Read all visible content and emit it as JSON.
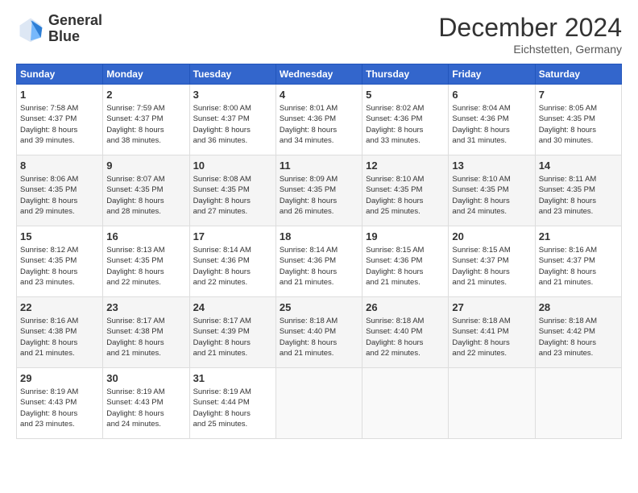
{
  "logo": {
    "line1": "General",
    "line2": "Blue"
  },
  "title": "December 2024",
  "location": "Eichstetten, Germany",
  "headers": [
    "Sunday",
    "Monday",
    "Tuesday",
    "Wednesday",
    "Thursday",
    "Friday",
    "Saturday"
  ],
  "weeks": [
    [
      {
        "day": "1",
        "lines": [
          "Sunrise: 7:58 AM",
          "Sunset: 4:37 PM",
          "Daylight: 8 hours",
          "and 39 minutes."
        ]
      },
      {
        "day": "2",
        "lines": [
          "Sunrise: 7:59 AM",
          "Sunset: 4:37 PM",
          "Daylight: 8 hours",
          "and 38 minutes."
        ]
      },
      {
        "day": "3",
        "lines": [
          "Sunrise: 8:00 AM",
          "Sunset: 4:37 PM",
          "Daylight: 8 hours",
          "and 36 minutes."
        ]
      },
      {
        "day": "4",
        "lines": [
          "Sunrise: 8:01 AM",
          "Sunset: 4:36 PM",
          "Daylight: 8 hours",
          "and 34 minutes."
        ]
      },
      {
        "day": "5",
        "lines": [
          "Sunrise: 8:02 AM",
          "Sunset: 4:36 PM",
          "Daylight: 8 hours",
          "and 33 minutes."
        ]
      },
      {
        "day": "6",
        "lines": [
          "Sunrise: 8:04 AM",
          "Sunset: 4:36 PM",
          "Daylight: 8 hours",
          "and 31 minutes."
        ]
      },
      {
        "day": "7",
        "lines": [
          "Sunrise: 8:05 AM",
          "Sunset: 4:35 PM",
          "Daylight: 8 hours",
          "and 30 minutes."
        ]
      }
    ],
    [
      {
        "day": "8",
        "lines": [
          "Sunrise: 8:06 AM",
          "Sunset: 4:35 PM",
          "Daylight: 8 hours",
          "and 29 minutes."
        ]
      },
      {
        "day": "9",
        "lines": [
          "Sunrise: 8:07 AM",
          "Sunset: 4:35 PM",
          "Daylight: 8 hours",
          "and 28 minutes."
        ]
      },
      {
        "day": "10",
        "lines": [
          "Sunrise: 8:08 AM",
          "Sunset: 4:35 PM",
          "Daylight: 8 hours",
          "and 27 minutes."
        ]
      },
      {
        "day": "11",
        "lines": [
          "Sunrise: 8:09 AM",
          "Sunset: 4:35 PM",
          "Daylight: 8 hours",
          "and 26 minutes."
        ]
      },
      {
        "day": "12",
        "lines": [
          "Sunrise: 8:10 AM",
          "Sunset: 4:35 PM",
          "Daylight: 8 hours",
          "and 25 minutes."
        ]
      },
      {
        "day": "13",
        "lines": [
          "Sunrise: 8:10 AM",
          "Sunset: 4:35 PM",
          "Daylight: 8 hours",
          "and 24 minutes."
        ]
      },
      {
        "day": "14",
        "lines": [
          "Sunrise: 8:11 AM",
          "Sunset: 4:35 PM",
          "Daylight: 8 hours",
          "and 23 minutes."
        ]
      }
    ],
    [
      {
        "day": "15",
        "lines": [
          "Sunrise: 8:12 AM",
          "Sunset: 4:35 PM",
          "Daylight: 8 hours",
          "and 23 minutes."
        ]
      },
      {
        "day": "16",
        "lines": [
          "Sunrise: 8:13 AM",
          "Sunset: 4:35 PM",
          "Daylight: 8 hours",
          "and 22 minutes."
        ]
      },
      {
        "day": "17",
        "lines": [
          "Sunrise: 8:14 AM",
          "Sunset: 4:36 PM",
          "Daylight: 8 hours",
          "and 22 minutes."
        ]
      },
      {
        "day": "18",
        "lines": [
          "Sunrise: 8:14 AM",
          "Sunset: 4:36 PM",
          "Daylight: 8 hours",
          "and 21 minutes."
        ]
      },
      {
        "day": "19",
        "lines": [
          "Sunrise: 8:15 AM",
          "Sunset: 4:36 PM",
          "Daylight: 8 hours",
          "and 21 minutes."
        ]
      },
      {
        "day": "20",
        "lines": [
          "Sunrise: 8:15 AM",
          "Sunset: 4:37 PM",
          "Daylight: 8 hours",
          "and 21 minutes."
        ]
      },
      {
        "day": "21",
        "lines": [
          "Sunrise: 8:16 AM",
          "Sunset: 4:37 PM",
          "Daylight: 8 hours",
          "and 21 minutes."
        ]
      }
    ],
    [
      {
        "day": "22",
        "lines": [
          "Sunrise: 8:16 AM",
          "Sunset: 4:38 PM",
          "Daylight: 8 hours",
          "and 21 minutes."
        ]
      },
      {
        "day": "23",
        "lines": [
          "Sunrise: 8:17 AM",
          "Sunset: 4:38 PM",
          "Daylight: 8 hours",
          "and 21 minutes."
        ]
      },
      {
        "day": "24",
        "lines": [
          "Sunrise: 8:17 AM",
          "Sunset: 4:39 PM",
          "Daylight: 8 hours",
          "and 21 minutes."
        ]
      },
      {
        "day": "25",
        "lines": [
          "Sunrise: 8:18 AM",
          "Sunset: 4:40 PM",
          "Daylight: 8 hours",
          "and 21 minutes."
        ]
      },
      {
        "day": "26",
        "lines": [
          "Sunrise: 8:18 AM",
          "Sunset: 4:40 PM",
          "Daylight: 8 hours",
          "and 22 minutes."
        ]
      },
      {
        "day": "27",
        "lines": [
          "Sunrise: 8:18 AM",
          "Sunset: 4:41 PM",
          "Daylight: 8 hours",
          "and 22 minutes."
        ]
      },
      {
        "day": "28",
        "lines": [
          "Sunrise: 8:18 AM",
          "Sunset: 4:42 PM",
          "Daylight: 8 hours",
          "and 23 minutes."
        ]
      }
    ],
    [
      {
        "day": "29",
        "lines": [
          "Sunrise: 8:19 AM",
          "Sunset: 4:43 PM",
          "Daylight: 8 hours",
          "and 23 minutes."
        ]
      },
      {
        "day": "30",
        "lines": [
          "Sunrise: 8:19 AM",
          "Sunset: 4:43 PM",
          "Daylight: 8 hours",
          "and 24 minutes."
        ]
      },
      {
        "day": "31",
        "lines": [
          "Sunrise: 8:19 AM",
          "Sunset: 4:44 PM",
          "Daylight: 8 hours",
          "and 25 minutes."
        ]
      },
      {
        "day": "",
        "lines": []
      },
      {
        "day": "",
        "lines": []
      },
      {
        "day": "",
        "lines": []
      },
      {
        "day": "",
        "lines": []
      }
    ]
  ]
}
